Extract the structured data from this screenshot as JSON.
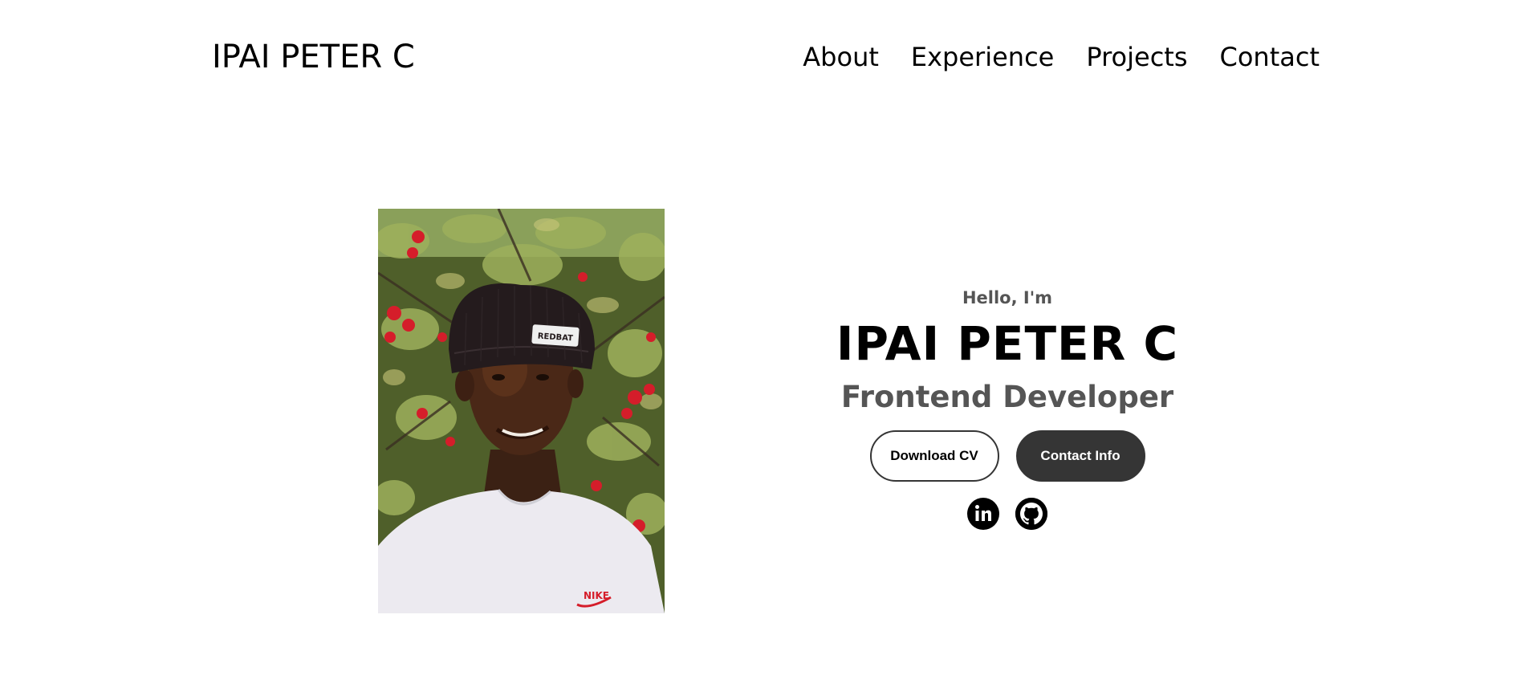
{
  "nav": {
    "logo": "IPAI PETER C",
    "links": [
      "About",
      "Experience",
      "Projects",
      "Contact"
    ]
  },
  "hero": {
    "greeting": "Hello, I'm",
    "name": "IPAI PETER C",
    "title": "Frontend Developer",
    "buttons": {
      "download_cv": "Download CV",
      "contact_info": "Contact Info"
    },
    "socials": [
      {
        "icon": "linkedin-icon"
      },
      {
        "icon": "github-icon"
      }
    ],
    "shirt_brand": "NIKE",
    "beanie_brand": "REDBAT"
  },
  "colors": {
    "text": "#000000",
    "muted": "#555555",
    "button_dark": "#353535",
    "background": "#ffffff"
  }
}
